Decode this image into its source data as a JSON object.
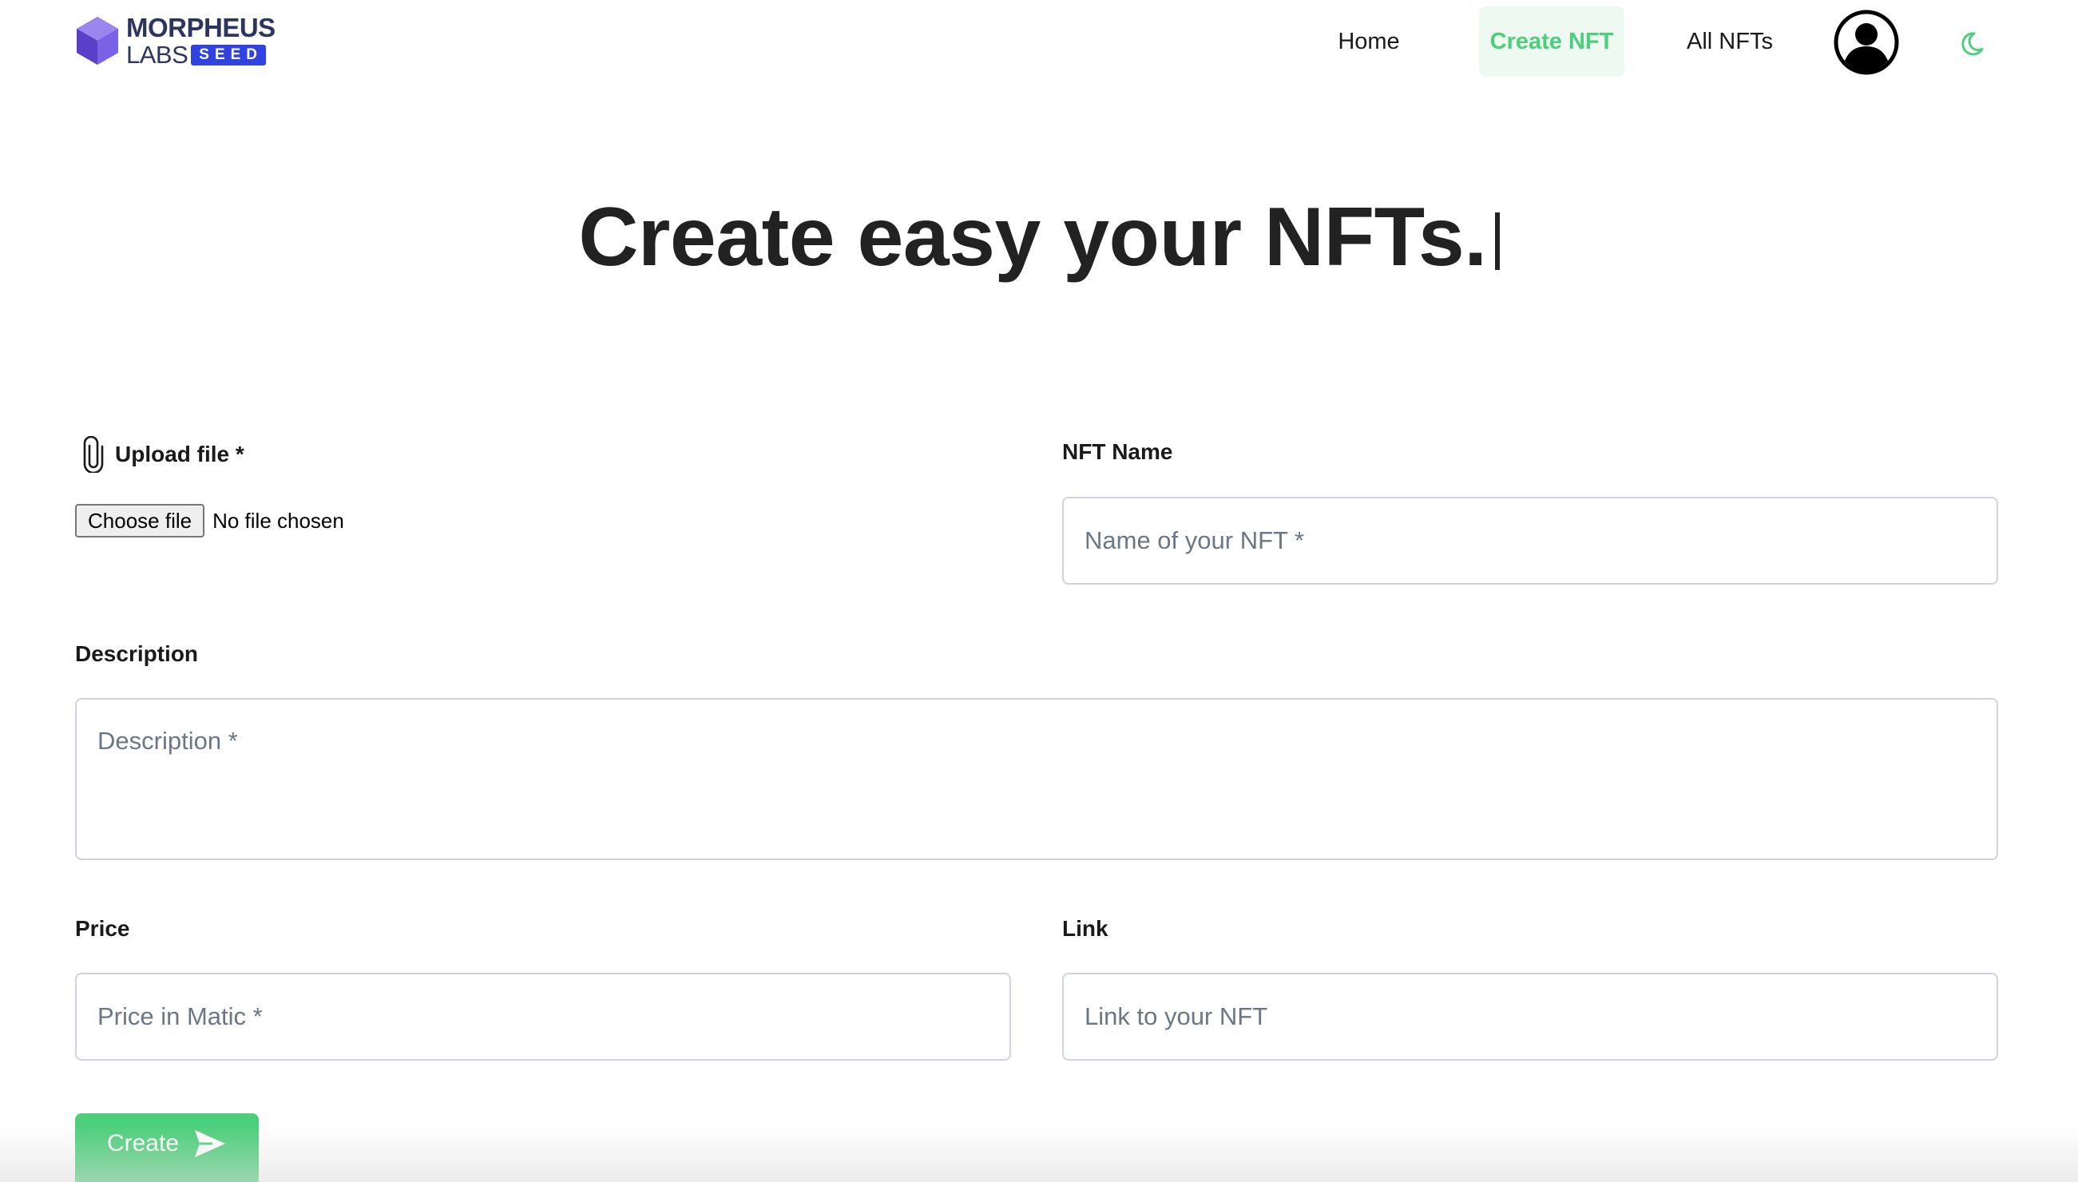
{
  "header": {
    "logo": {
      "top": "MORPHEUS",
      "labs": "LABS",
      "seed": "SEED",
      "icon": "hexagon-cube-logo"
    },
    "nav": {
      "home": "Home",
      "create_nft": "Create NFT",
      "all_nfts": "All NFTs",
      "active": "Create NFT"
    },
    "avatar_icon": "user-circle-icon",
    "theme_icon": "moon-icon"
  },
  "hero": {
    "title": "Create easy your NFTs."
  },
  "form": {
    "upload": {
      "label": "Upload file *",
      "icon": "paperclip-icon",
      "button": "Choose file",
      "status": "No file chosen"
    },
    "nft_name": {
      "label": "NFT Name",
      "placeholder": "Name of your NFT *",
      "value": ""
    },
    "description": {
      "label": "Description",
      "placeholder": "Description *",
      "value": ""
    },
    "price": {
      "label": "Price",
      "placeholder": "Price in Matic *",
      "value": ""
    },
    "link": {
      "label": "Link",
      "placeholder": "Link to your NFT",
      "value": ""
    },
    "submit": {
      "label": "Create",
      "icon": "send-icon"
    }
  },
  "colors": {
    "accent": "#4ccf7a",
    "accent_bg": "#eefaf1",
    "logo_navy": "#2b3560",
    "logo_blue": "#3042e0",
    "logo_purple": "#7b5fe0"
  }
}
